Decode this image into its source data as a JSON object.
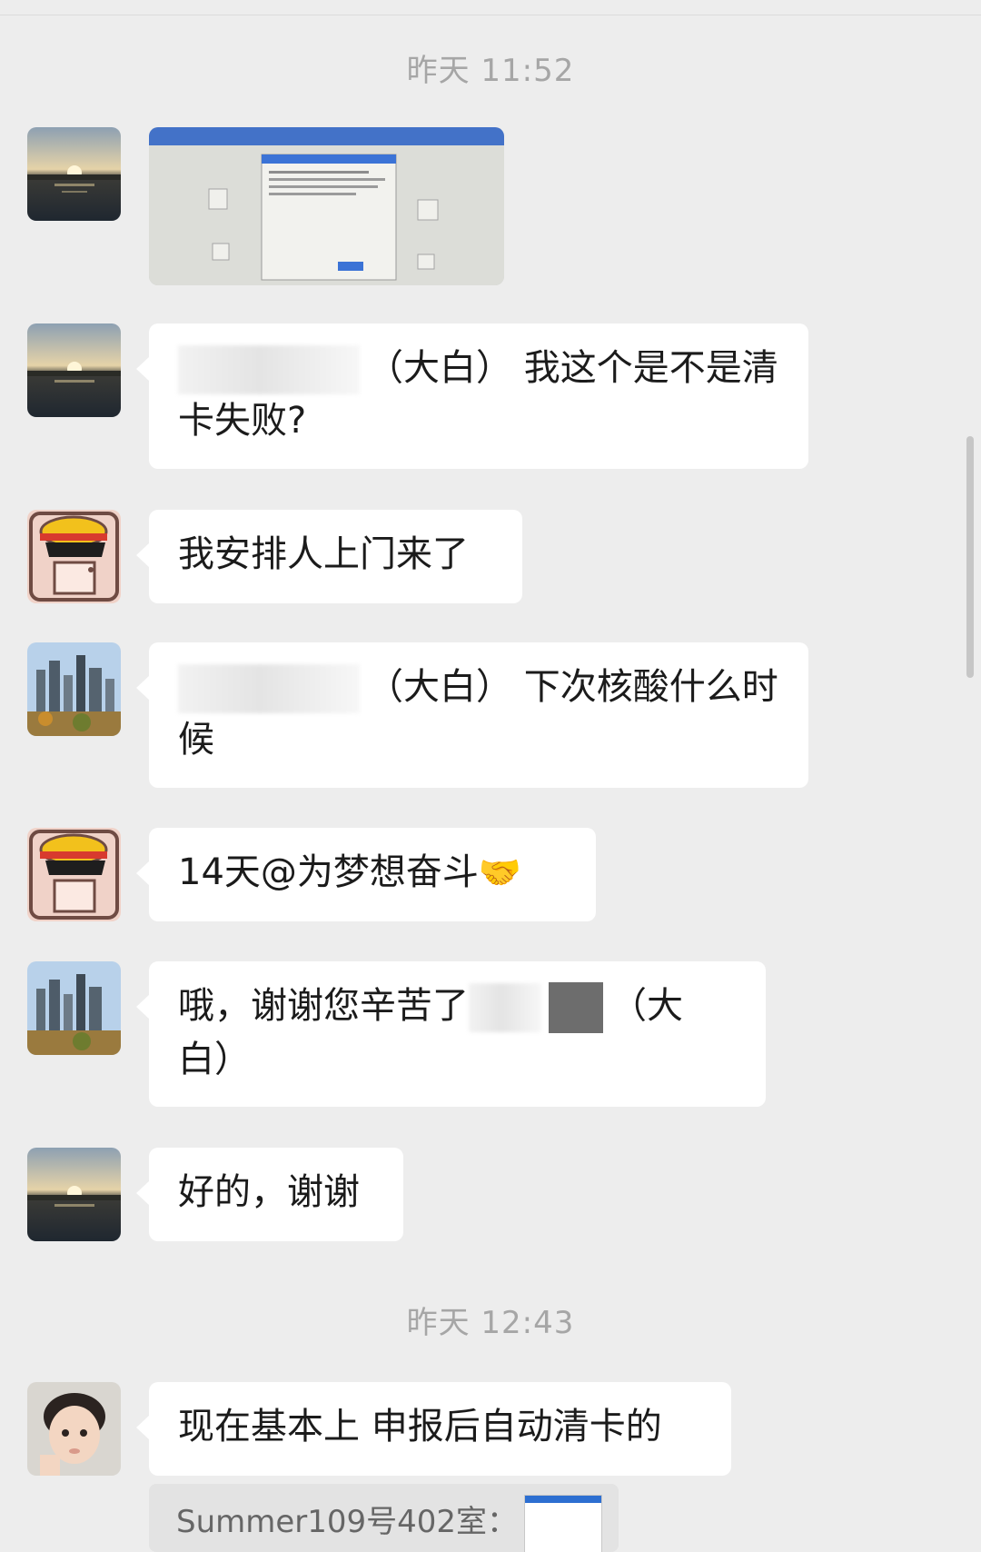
{
  "chat": {
    "timestamps": [
      "昨天 11:52",
      "昨天 12:43"
    ],
    "messages": [
      {
        "text_after": "（大白） 我这个是不是清卡失败?"
      },
      {
        "text": "我安排人上门来了"
      },
      {
        "text_after": "（大白） 下次核酸什么时候"
      },
      {
        "text": "14天@为梦想奋斗",
        "emoji": "🤝"
      },
      {
        "text_before": "哦，谢谢您辛苦了",
        "text_after": "（大白）"
      },
      {
        "text": "好的，谢谢"
      },
      {
        "text": "现在基本上 申报后自动清卡的"
      }
    ],
    "quote": {
      "text": "Summer109号402室："
    }
  },
  "avatars": [
    "sunset-lake-avatar",
    "straw-hat-cartoon-avatar",
    "city-skyline-avatar",
    "child-photo-avatar"
  ],
  "colors": {
    "background": "#ededed",
    "bubble": "#ffffff",
    "timestamp": "#a6a6a6",
    "dialog_blue": "#2d6fd1"
  }
}
